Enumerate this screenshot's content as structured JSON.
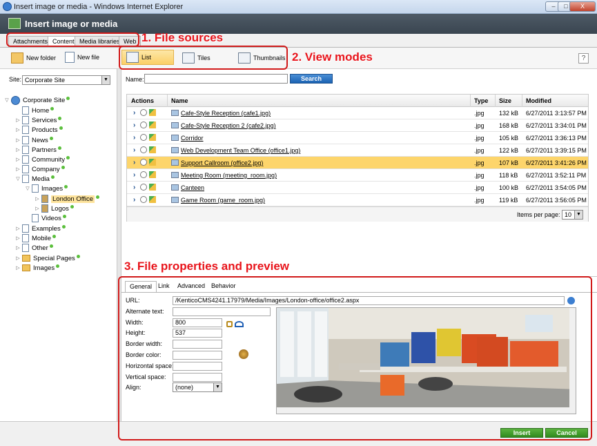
{
  "window": {
    "title": "Insert image or media - Windows Internet Explorer",
    "min": "–",
    "max": "□",
    "close": "X"
  },
  "dialog": {
    "title": "Insert image or media"
  },
  "source_tabs": [
    "Attachments",
    "Content",
    "Media libraries",
    "Web"
  ],
  "annotations": {
    "sources": "1. File sources",
    "views": "2. View modes",
    "props": "3. File properties and preview"
  },
  "left_toolbar": {
    "new_folder": "New folder",
    "new_file": "New file"
  },
  "view_modes": {
    "list": "List",
    "tiles": "Tiles",
    "thumbnails": "Thumbnails",
    "help": "?"
  },
  "site": {
    "label": "Site:",
    "value": "Corporate Site"
  },
  "tree": {
    "root": "Corporate Site",
    "items": [
      "Home",
      "Services",
      "Products",
      "News",
      "Partners",
      "Community",
      "Company",
      "Media",
      "Images",
      "London Office",
      "Logos",
      "Videos",
      "Examples",
      "Mobile",
      "Other",
      "Special Pages",
      "Images"
    ]
  },
  "search": {
    "name_label": "Name:",
    "button": "Search"
  },
  "grid": {
    "headers": {
      "actions": "Actions",
      "name": "Name",
      "type": "Type",
      "size": "Size",
      "modified": "Modified"
    },
    "rows": [
      {
        "name": "Cafe-Style Reception (cafe1.jpg)",
        "type": ".jpg",
        "size": "132 kB",
        "modified": "6/27/2011 3:13:57 PM"
      },
      {
        "name": "Cafe-Style Reception 2 (cafe2.jpg)",
        "type": ".jpg",
        "size": "168 kB",
        "modified": "6/27/2011 3:34:01 PM"
      },
      {
        "name": "Corridor",
        "type": ".jpg",
        "size": "105 kB",
        "modified": "6/27/2011 3:36:13 PM"
      },
      {
        "name": "Web Development Team Office (office1.jpg)",
        "type": ".jpg",
        "size": "122 kB",
        "modified": "6/27/2011 3:39:15 PM"
      },
      {
        "name": "Support Callroom (office2.jpg)",
        "type": ".jpg",
        "size": "107 kB",
        "modified": "6/27/2011 3:41:26 PM"
      },
      {
        "name": "Meeting Room (meeting_room.jpg)",
        "type": ".jpg",
        "size": "118 kB",
        "modified": "6/27/2011 3:52:11 PM"
      },
      {
        "name": "Canteen",
        "type": ".jpg",
        "size": "100 kB",
        "modified": "6/27/2011 3:54:05 PM"
      },
      {
        "name": "Game Room (game_room.jpg)",
        "type": ".jpg",
        "size": "119 kB",
        "modified": "6/27/2011 3:56:05 PM"
      }
    ],
    "items_per_page_label": "Items per page:",
    "items_per_page": "10"
  },
  "props": {
    "tabs": [
      "General",
      "Link",
      "Advanced",
      "Behavior"
    ],
    "url_label": "URL:",
    "url": "/KenticoCMS4241.17979/Media/Images/London-office/office2.aspx",
    "alt_label": "Alternate text:",
    "width_label": "Width:",
    "width": "800",
    "height_label": "Height:",
    "height": "537",
    "border_width_label": "Border width:",
    "border_color_label": "Border color:",
    "hspace_label": "Horizontal space:",
    "vspace_label": "Vertical space:",
    "align_label": "Align:",
    "align": "(none)"
  },
  "footer": {
    "insert": "Insert",
    "cancel": "Cancel"
  }
}
